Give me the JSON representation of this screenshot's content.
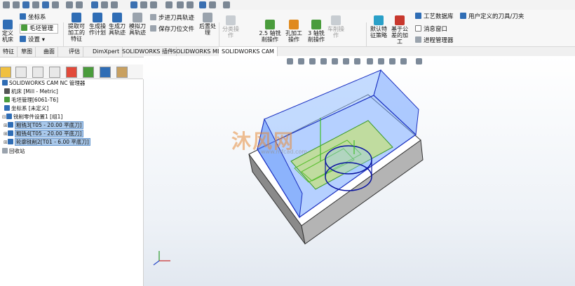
{
  "ribbon": {
    "left_btn": "定义机床",
    "coord": "坐标系",
    "stock": "毛坯管理",
    "setup": "设置",
    "extract": "提取可加工的特征",
    "gen_plan": "生成操作计划",
    "gen_path": "生成刀具轨迹",
    "sim_path": "模拟刀具轨迹",
    "step_path": "步进刀具轨迹",
    "save_loc": "保存刀位文件",
    "post": "后置处理",
    "ops_dim": "分类操作",
    "ops_25": "2.5 轴铣削操作",
    "ops_lathe": "孔加工操作",
    "ops_3": "3 轴铣削操作",
    "ops_turn": "车削操作",
    "strategy": "默认特征策略",
    "public": "基于公差的加工",
    "tech_db": "工艺数据库",
    "msg_window": "消息窗口",
    "process_mgr": "进程管理器",
    "user_tool": "用户定义的刀具/刀夹"
  },
  "tabs": [
    "特征",
    "草图",
    "曲面",
    "评估",
    "DimXpert",
    "SOLIDWORKS 插件",
    "SOLIDWORKS MBD",
    "SOLIDWORKS CAM"
  ],
  "tree": {
    "root": "SOLIDWORKS CAM NC 管理器",
    "machine": "机床 [Mill - Metric]",
    "stock": "毛坯管理[6061-T6]",
    "coord": "坐标系 [未定义]",
    "setup": "铣削零件设置1 [组1]",
    "op1": "粗铣3[T05 - 20.00 平底刀]",
    "op2": "粗铣4[T05 - 20.00 平底刀]",
    "op3": "轮廓铣削2[T01 - 6.00 平底刀]",
    "recycle": "回收站"
  },
  "watermark": "沐风网",
  "watermark_sub": "www.mfcad.com"
}
